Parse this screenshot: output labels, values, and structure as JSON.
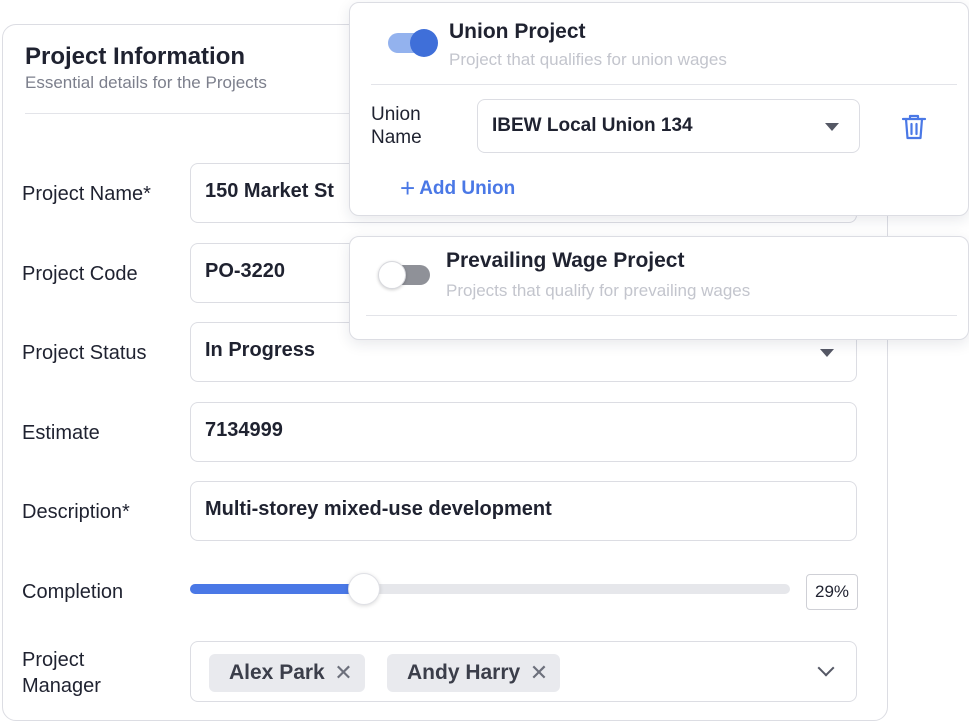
{
  "card": {
    "title": "Project Information",
    "subtitle": "Essential details for the Projects"
  },
  "fields": {
    "project_name": {
      "label": "Project Name*",
      "value": "150 Market St"
    },
    "project_code": {
      "label": "Project Code",
      "value": "PO-3220"
    },
    "project_status": {
      "label": "Project Status",
      "value": "In Progress"
    },
    "estimate": {
      "label": "Estimate",
      "value": "7134999"
    },
    "description": {
      "label": "Description*",
      "value": "Multi-storey mixed-use development"
    },
    "completion": {
      "label": "Completion",
      "value_text": "29%",
      "fraction": 0.29
    },
    "project_manager": {
      "label_line1": "Project",
      "label_line2": "Manager",
      "chips": [
        "Alex Park",
        "Andy Harry"
      ],
      "remove_glyph": "✕"
    }
  },
  "union": {
    "title": "Union Project",
    "subtitle": "Project that qualifies for union wages",
    "enabled": true,
    "name_label_line1": "Union",
    "name_label_line2": "Name",
    "selected": "IBEW Local Union 134",
    "add_label": "Add Union",
    "add_glyph": "+",
    "delete_icon": "trash-icon"
  },
  "prevailing": {
    "title": "Prevailing Wage Project",
    "subtitle": "Projects that qualify for prevailing wages",
    "enabled": false
  },
  "colors": {
    "accent": "#4a78e6",
    "toggle_on_track": "#93b2ee",
    "toggle_on_knob": "#3f6fd9",
    "toggle_off_track": "#8f9198"
  }
}
